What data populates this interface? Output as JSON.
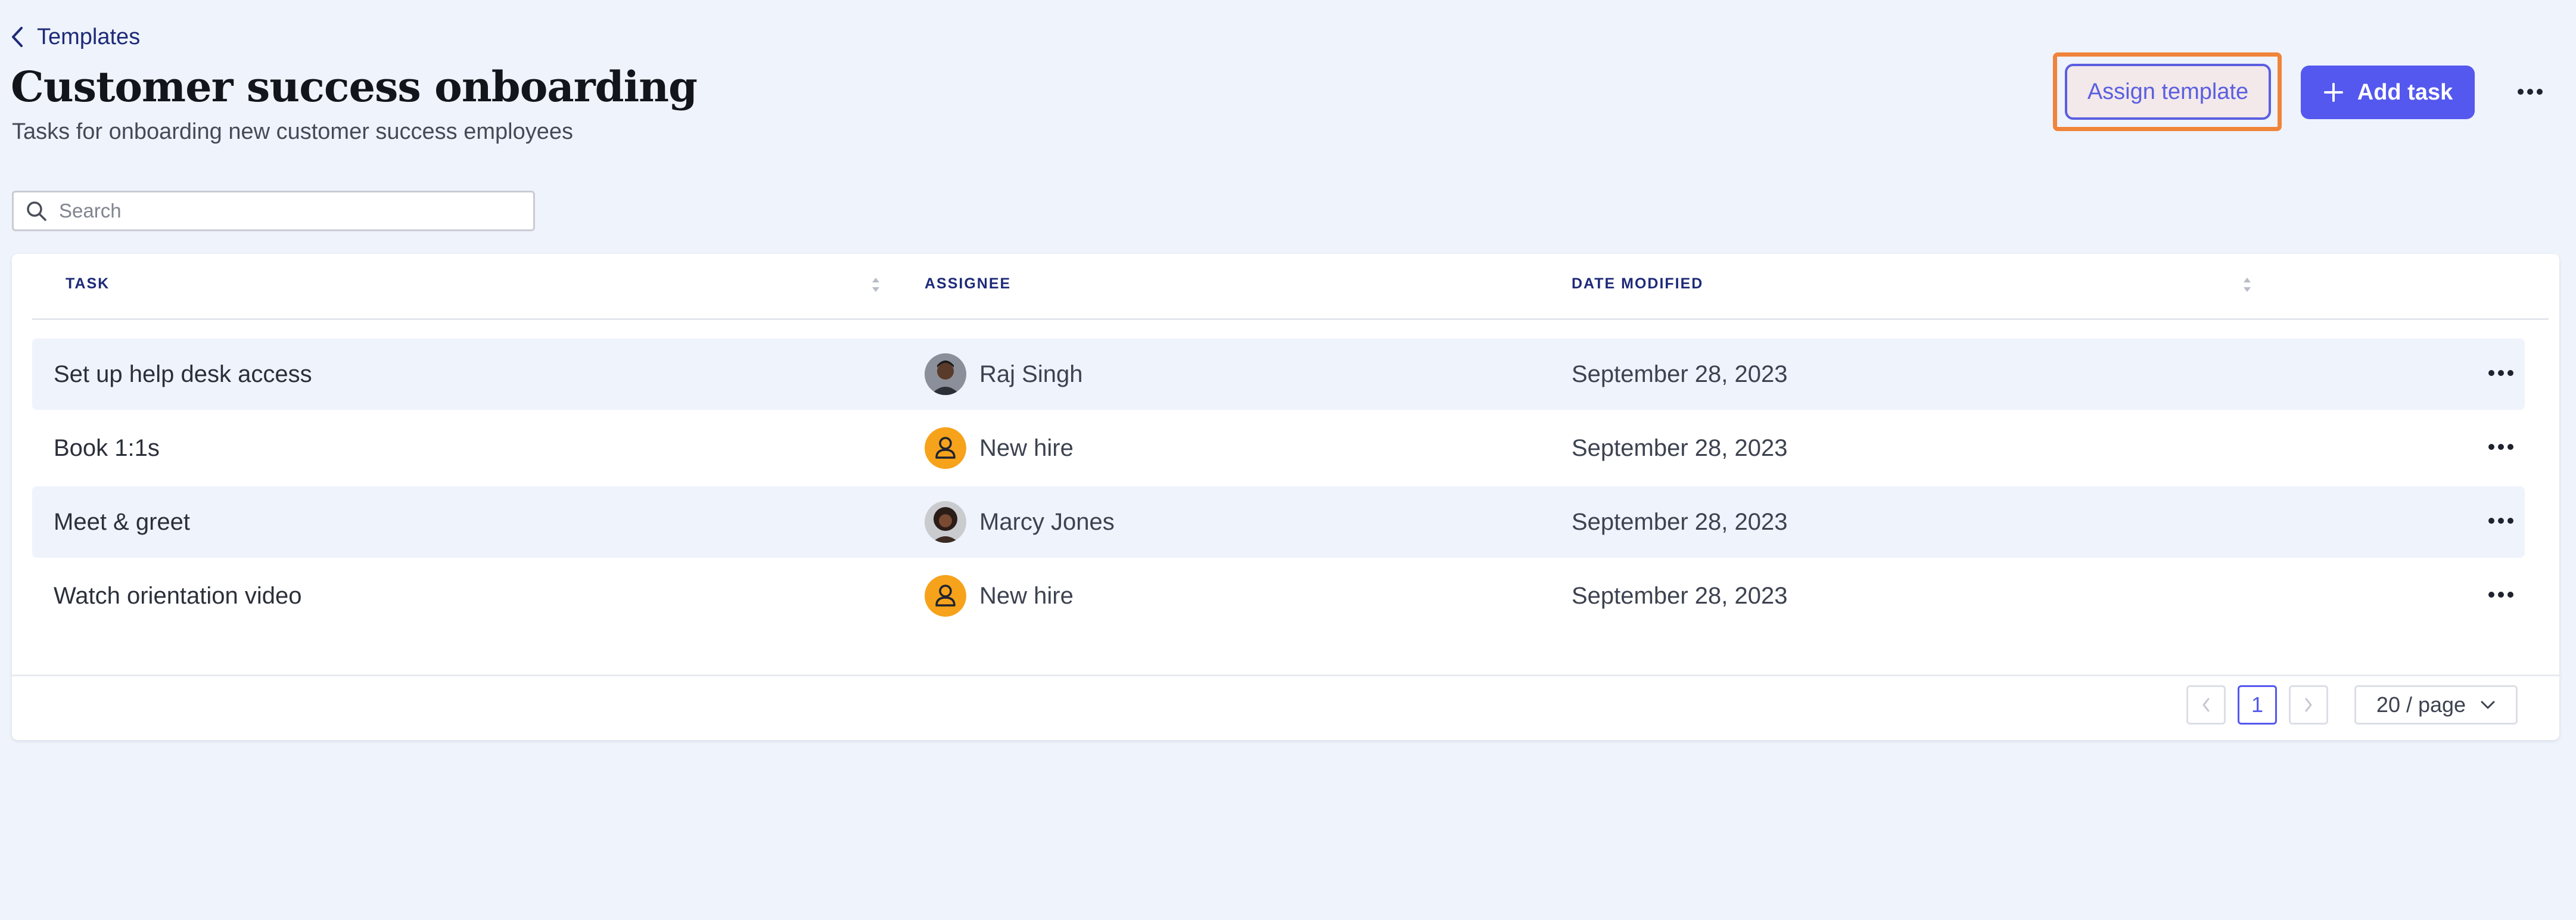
{
  "breadcrumb": {
    "back_label": "Templates"
  },
  "page": {
    "title": "Customer success onboarding",
    "subtitle": "Tasks for onboarding new customer success employees"
  },
  "actions": {
    "assign_label": "Assign template",
    "add_label": "Add task",
    "more_icon": "more-horizontal-icon"
  },
  "search": {
    "placeholder": "Search",
    "value": ""
  },
  "table": {
    "columns": [
      "TASK",
      "ASSIGNEE",
      "DATE MODIFIED"
    ],
    "rows": [
      {
        "task": "Set up help desk access",
        "assignee": "Raj Singh",
        "avatar": "photo",
        "date": "September 28, 2023"
      },
      {
        "task": "Book 1:1s",
        "assignee": "New hire",
        "avatar": "person-icon",
        "date": "September 28, 2023"
      },
      {
        "task": "Meet & greet",
        "assignee": "Marcy Jones",
        "avatar": "photo",
        "date": "September 28, 2023"
      },
      {
        "task": "Watch orientation video",
        "assignee": "New hire",
        "avatar": "person-icon",
        "date": "September 28, 2023"
      }
    ]
  },
  "pagination": {
    "current_page": "1",
    "page_size": "20 / page"
  },
  "colors": {
    "accent": "#5458ee",
    "highlight_outline": "#f0843a",
    "background": "#eff3fb",
    "avatar_placeholder": "#f7a21b"
  }
}
